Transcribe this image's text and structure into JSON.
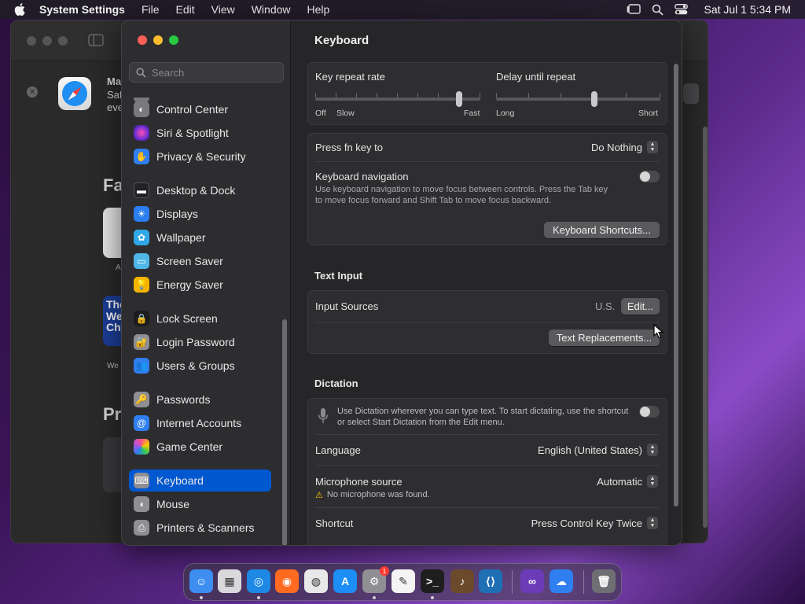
{
  "menubar": {
    "app_name": "System Settings",
    "items": [
      "File",
      "Edit",
      "View",
      "Window",
      "Help"
    ],
    "clock": "Sat Jul 1  5:34 PM"
  },
  "background_window": {
    "title_fragment": "Ma",
    "line1": "Saf",
    "line2": "eve",
    "heading1": "Fa",
    "heading2": "Pr",
    "tile_label": "A",
    "tile2_text": "The We Cha",
    "tile2_caption": "We"
  },
  "sidebar": {
    "search_placeholder": "Search",
    "items": [
      {
        "label": "Control Center",
        "icon": "control-center-icon",
        "color": "#7a7a7e"
      },
      {
        "label": "Siri & Spotlight",
        "icon": "siri-icon",
        "color": "#c0379a"
      },
      {
        "label": "Privacy & Security",
        "icon": "hand-icon",
        "color": "#2f7ff0"
      },
      {
        "label": "Desktop & Dock",
        "icon": "desktop-icon",
        "color": "#222226"
      },
      {
        "label": "Displays",
        "icon": "sun-icon",
        "color": "#2b7ef0"
      },
      {
        "label": "Wallpaper",
        "icon": "flower-icon",
        "color": "#30a8e6"
      },
      {
        "label": "Screen Saver",
        "icon": "screen-saver-icon",
        "color": "#4fb6e8"
      },
      {
        "label": "Energy Saver",
        "icon": "bulb-icon",
        "color": "#f4b400"
      },
      {
        "label": "Lock Screen",
        "icon": "lock-icon",
        "color": "#1c1c1e"
      },
      {
        "label": "Login Password",
        "icon": "padlock-icon",
        "color": "#8e8e93"
      },
      {
        "label": "Users & Groups",
        "icon": "users-icon",
        "color": "#2f7ff0"
      },
      {
        "label": "Passwords",
        "icon": "key-icon",
        "color": "#8e8e93"
      },
      {
        "label": "Internet Accounts",
        "icon": "at-icon",
        "color": "#2f7ff0"
      },
      {
        "label": "Game Center",
        "icon": "game-center-icon",
        "color": "#e8e8e8"
      },
      {
        "label": "Keyboard",
        "icon": "keyboard-icon",
        "color": "#8e8e93"
      },
      {
        "label": "Mouse",
        "icon": "mouse-icon",
        "color": "#8e8e93"
      },
      {
        "label": "Printers & Scanners",
        "icon": "printer-icon",
        "color": "#8e8e93"
      }
    ],
    "selected": "Keyboard"
  },
  "content": {
    "title": "Keyboard",
    "key_repeat": {
      "label": "Key repeat rate",
      "left_labels": [
        "Off",
        "Slow"
      ],
      "right_label": "Fast",
      "value": 0.87
    },
    "delay_repeat": {
      "label": "Delay until repeat",
      "left_label": "Long",
      "right_label": "Short",
      "value": 0.6
    },
    "fn_key": {
      "label": "Press fn key to",
      "value": "Do Nothing"
    },
    "keyboard_nav": {
      "label": "Keyboard navigation",
      "desc1": "Use keyboard navigation to move focus between controls. Press the Tab key",
      "desc2": "to move focus forward and Shift Tab to move focus backward.",
      "enabled": false
    },
    "shortcuts_button": "Keyboard Shortcuts...",
    "text_input_header": "Text Input",
    "input_sources": {
      "label": "Input Sources",
      "value": "U.S.",
      "button": "Edit..."
    },
    "text_replacements_button": "Text Replacements...",
    "dictation_header": "Dictation",
    "dictation": {
      "desc1": "Use Dictation wherever you can type text. To start dictating, use the shortcut",
      "desc2": "or select Start Dictation from the Edit menu.",
      "enabled": false
    },
    "language": {
      "label": "Language",
      "value": "English (United States)"
    },
    "microphone": {
      "label": "Microphone source",
      "value": "Automatic",
      "warning": "No microphone was found."
    },
    "shortcut": {
      "label": "Shortcut",
      "value": "Press Control Key Twice"
    }
  },
  "dock": {
    "apps": [
      {
        "name": "finder-icon",
        "color": "#3d8ef0"
      },
      {
        "name": "launchpad-icon",
        "color": "#d9d9dc"
      },
      {
        "name": "safari-icon",
        "color": "#1e88e5"
      },
      {
        "name": "firefox-icon",
        "color": "#ff6a21"
      },
      {
        "name": "chrome-icon",
        "color": "#e8e8e8"
      },
      {
        "name": "app-store-icon",
        "color": "#1c8ef5"
      },
      {
        "name": "system-settings-icon",
        "color": "#8e8e93"
      },
      {
        "name": "textedit-icon",
        "color": "#f4f4f4"
      },
      {
        "name": "terminal-icon",
        "color": "#1e1e1e"
      },
      {
        "name": "instruments-icon",
        "color": "#6b4a2b"
      },
      {
        "name": "vscode-icon",
        "color": "#1f6fb5"
      },
      {
        "name": "visual-studio-icon",
        "color": "#6b3bb8"
      },
      {
        "name": "weather-icon",
        "color": "#2f7ff0"
      },
      {
        "name": "trash-icon",
        "color": "#6f6f73"
      }
    ],
    "settings_badge": "1"
  }
}
